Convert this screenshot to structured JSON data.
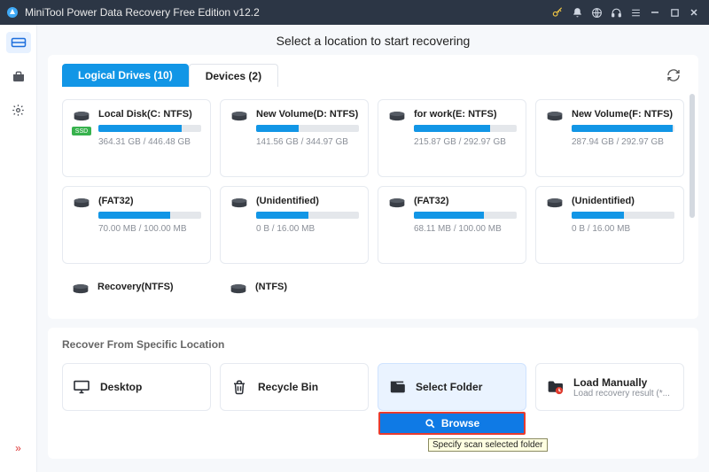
{
  "title": "MiniTool Power Data Recovery Free Edition v12.2",
  "heading": "Select a location to start recovering",
  "tabs": {
    "logical": "Logical Drives (10)",
    "devices": "Devices (2)"
  },
  "drives": [
    {
      "name": "Local Disk(C: NTFS)",
      "usage": "364.31 GB / 446.48 GB",
      "fill": 81,
      "ssd": true
    },
    {
      "name": "New Volume(D: NTFS)",
      "usage": "141.56 GB / 344.97 GB",
      "fill": 41
    },
    {
      "name": "for work(E: NTFS)",
      "usage": "215.87 GB / 292.97 GB",
      "fill": 74
    },
    {
      "name": "New Volume(F: NTFS)",
      "usage": "287.94 GB / 292.97 GB",
      "fill": 98
    },
    {
      "name": "(FAT32)",
      "usage": "70.00 MB / 100.00 MB",
      "fill": 70
    },
    {
      "name": "(Unidentified)",
      "usage": "0 B / 16.00 MB",
      "fill": 51
    },
    {
      "name": "(FAT32)",
      "usage": "68.11 MB / 100.00 MB",
      "fill": 68
    },
    {
      "name": "(Unidentified)",
      "usage": "0 B / 16.00 MB",
      "fill": 51
    },
    {
      "name": "Recovery(NTFS)"
    },
    {
      "name": "(NTFS)"
    }
  ],
  "lower_title": "Recover From Specific Location",
  "locations": {
    "desktop": "Desktop",
    "recycle": "Recycle Bin",
    "select": "Select Folder",
    "load_title": "Load Manually",
    "load_sub": "Load recovery result (*..."
  },
  "browse_label": "Browse",
  "tooltip": "Specify scan selected folder",
  "ssd_label": "SSD"
}
